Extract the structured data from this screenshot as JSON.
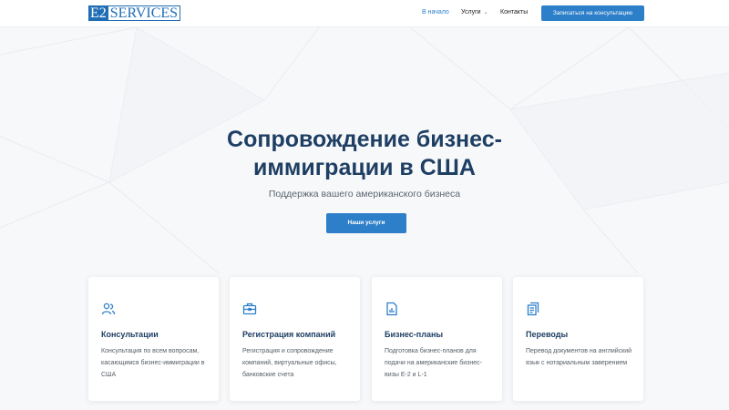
{
  "header": {
    "logo": {
      "box": "E2",
      "text": "SERVICES"
    },
    "nav": [
      {
        "label": "В начало",
        "active": true
      },
      {
        "label": "Услуги",
        "has_dropdown": true
      },
      {
        "label": "Контакты"
      }
    ],
    "cta_label": "Записаться на консультацию"
  },
  "hero": {
    "title_line1": "Сопровождение бизнес-",
    "title_line2": "иммиграции в США",
    "subtitle": "Поддержка вашего американского бизнеса",
    "button_label": "Наши услуги"
  },
  "services": [
    {
      "icon": "users-icon",
      "title": "Консультации",
      "text": "Консультация по всем вопросам, касающимся бизнес-иммиграции в США"
    },
    {
      "icon": "briefcase-icon",
      "title": "Регистрация компаний",
      "text": "Регистрация и сопровождение компаний, виртуальные офисы, банковские счета"
    },
    {
      "icon": "chart-document-icon",
      "title": "Бизнес-планы",
      "text": "Подготовка бизнес-планов для подачи на американские бизнес-визы E-2 и L-1"
    },
    {
      "icon": "documents-icon",
      "title": "Переводы",
      "text": "Перевод документов на английский язык с нотариальным заверением"
    }
  ],
  "colors": {
    "accent": "#2d7fc9",
    "heading": "#1e3f63",
    "background": "#f7f8fa"
  }
}
